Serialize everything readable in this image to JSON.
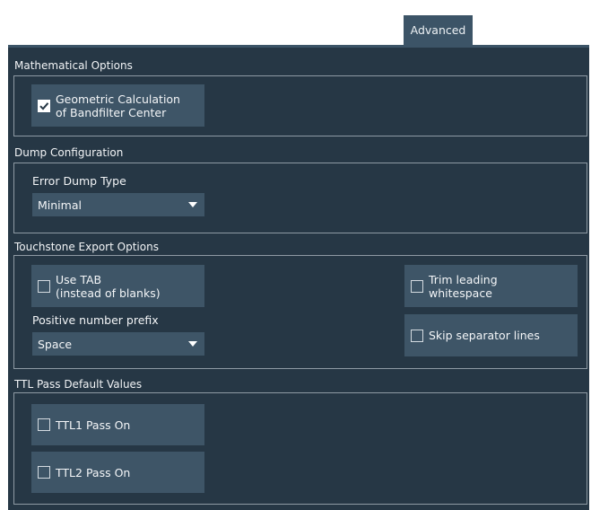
{
  "tab": {
    "label": "Advanced"
  },
  "math": {
    "title": "Mathematical Options",
    "geo": {
      "line1": "Geometric Calculation",
      "line2": "of Bandfilter Center",
      "checked": true
    }
  },
  "dump": {
    "title": "Dump Configuration",
    "error_label": "Error Dump Type",
    "error_value": "Minimal"
  },
  "touch": {
    "title": "Touchstone Export Options",
    "use_tab": {
      "line1": "Use TAB",
      "line2": "(instead of blanks)",
      "checked": false
    },
    "prefix_label": "Positive number prefix",
    "prefix_value": "Space",
    "trim": {
      "line1": "Trim leading",
      "line2": "whitespace",
      "checked": false
    },
    "skip": {
      "label": "Skip separator lines",
      "checked": false
    }
  },
  "ttl": {
    "title": "TTL Pass Default Values",
    "ttl1": {
      "label": "TTL1 Pass On",
      "checked": false
    },
    "ttl2": {
      "label": "TTL2 Pass On",
      "checked": false
    }
  }
}
